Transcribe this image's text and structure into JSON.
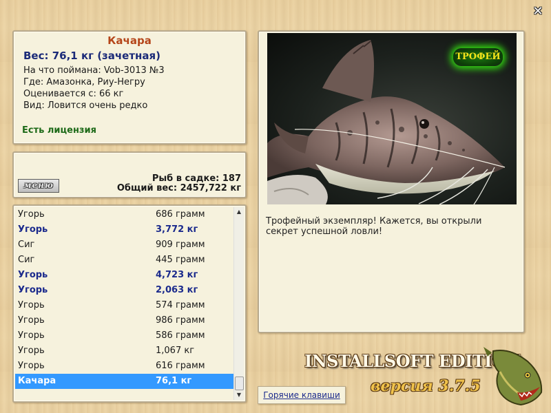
{
  "window": {
    "close_icon": "close-icon"
  },
  "fish": {
    "name": "Качара",
    "weight_line": "Вес: 76,1 кг (зачетная)",
    "bait_line": "На что поймана: Vob-3013 №3",
    "location_line": "Где: Амазонка, Риу-Негру",
    "value_line": "Оценивается с: 66 кг",
    "rarity_line": "Вид: Ловится очень редко",
    "license": "Есть лицензия"
  },
  "stats": {
    "menu_label": "меню",
    "count_line": "Рыб в садке: 187",
    "total_weight_line": "Общий вес: 2457,722 кг"
  },
  "catch_list": [
    {
      "name": "Угорь",
      "weight": "686 грамм",
      "bold": false
    },
    {
      "name": "Угорь",
      "weight": "3,772 кг",
      "bold": true
    },
    {
      "name": "Сиг",
      "weight": "909 грамм",
      "bold": false
    },
    {
      "name": "Сиг",
      "weight": "445 грамм",
      "bold": false
    },
    {
      "name": "Угорь",
      "weight": "4,723 кг",
      "bold": true
    },
    {
      "name": "Угорь",
      "weight": "2,063 кг",
      "bold": true
    },
    {
      "name": "Угорь",
      "weight": "574 грамм",
      "bold": false
    },
    {
      "name": "Угорь",
      "weight": "986 грамм",
      "bold": false
    },
    {
      "name": "Угорь",
      "weight": "586 грамм",
      "bold": false
    },
    {
      "name": "Угорь",
      "weight": "1,067 кг",
      "bold": false
    },
    {
      "name": "Угорь",
      "weight": "616 грамм",
      "bold": false
    },
    {
      "name": "Качара",
      "weight": "76,1 кг",
      "bold": true,
      "selected": true
    }
  ],
  "photo": {
    "trophy_badge": "ТРОФЕЙ",
    "caption": "Трофейный экземпляр! Кажется, вы открыли секрет успешной ловли!"
  },
  "footer": {
    "hotkeys_label": "Горячие клавиши",
    "edition": "INSTALLSOFT EDITION",
    "version": "версия 3.7.5"
  },
  "colors": {
    "title": "#b5461a",
    "weight": "#1b2a78",
    "license": "#1d6a18",
    "selection": "#3399ff",
    "trophy_glow": "#33dd11"
  }
}
